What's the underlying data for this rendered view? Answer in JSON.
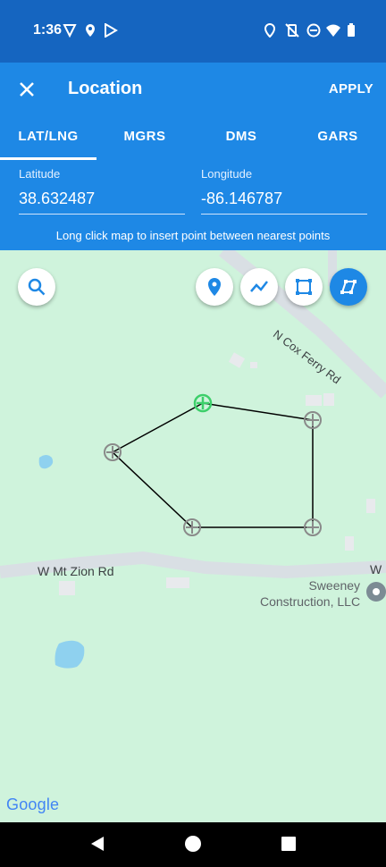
{
  "status_bar": {
    "time": "1:36"
  },
  "app_bar": {
    "title": "Location",
    "apply_label": "APPLY"
  },
  "tabs": [
    {
      "label": "LAT/LNG"
    },
    {
      "label": "MGRS"
    },
    {
      "label": "DMS"
    },
    {
      "label": "GARS"
    }
  ],
  "fields": {
    "latitude": {
      "label": "Latitude",
      "value": "38.632487"
    },
    "longitude": {
      "label": "Longitude",
      "value": "-86.146787"
    }
  },
  "hint": "Long click map to insert point between nearest points",
  "map": {
    "roads": {
      "cox": "N Cox Ferry Rd",
      "zion": "W Mt Zion Rd",
      "zion_edge": "W M"
    },
    "poi": {
      "line1": "Sweeney",
      "line2": "Construction, LLC"
    },
    "google_logo": "Google"
  },
  "colors": {
    "status_bar": "#1565c0",
    "app_bar": "#1e88e5",
    "map_bg": "#cff3dc",
    "selected_point": "#3ccf6a"
  }
}
